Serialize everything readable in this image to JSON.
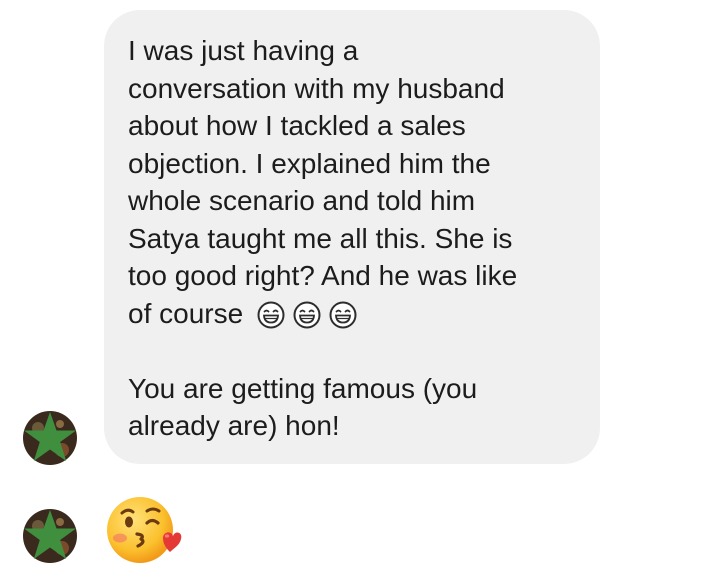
{
  "message_1": {
    "lines": [
      "I was just having a",
      "conversation with my husband",
      "about how I tackled a sales",
      "objection. I explained him the",
      "whole scenario and told him",
      "Satya taught me all this. She is",
      "too good right? And he was like",
      "of course"
    ],
    "emojis": [
      "grinning-squint-emoji",
      "grinning-squint-emoji",
      "grinning-squint-emoji"
    ],
    "lines_after_break": [
      "You are getting famous (you",
      "already are) hon!"
    ]
  },
  "message_2": {
    "emoji": "kissing-face-blowing-heart-emoji"
  },
  "colors": {
    "bubble_bg": "#f0f0f0",
    "text": "#1c1c1c",
    "avatar_star": "#3f8f3f",
    "emoji_yellow": "#fbc02d",
    "heart": "#e53935"
  }
}
